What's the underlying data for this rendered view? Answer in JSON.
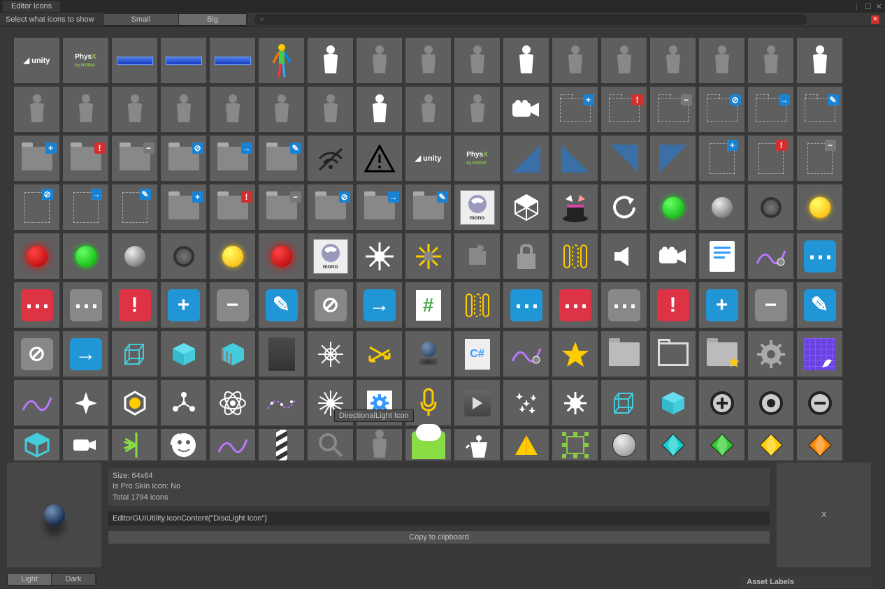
{
  "window": {
    "title": "Editor Icons",
    "controls": {
      "kebab": "⋮",
      "max": "☐",
      "close": "✕"
    }
  },
  "toolbar": {
    "label": "Select what icons to show",
    "sizes": {
      "small": "Small",
      "big": "Big"
    },
    "search_placeholder": "",
    "search_icon": "⌕"
  },
  "tooltip": "DirectionalLight Icon",
  "detail": {
    "size_label": "Size: 64x64",
    "proskin_label": "Is Pro Skin Icon: No",
    "total_label": "Total 1794 icons",
    "code": "EditorGUIUtility.IconContent(\"DiscLight Icon\")",
    "copy_label": "Copy to clipboard",
    "assign_label": "X"
  },
  "theme": {
    "light": "Light",
    "dark": "Dark"
  },
  "asset_labels": "Asset Labels",
  "icons": {
    "r0": [
      "unity",
      "physx",
      "bluebar",
      "bluebar",
      "bluebar",
      "avatar-color",
      "avatar-white",
      "avatar-outline",
      "avatar-dotted",
      "head",
      "head-white",
      "bodypart-1",
      "bodypart-2",
      "bodypart-3",
      "bodypart-4",
      "hand-outline",
      "hand-white"
    ],
    "r1": [
      "leg-1",
      "leg-2",
      "leg-3",
      "arm",
      "shoulder",
      "arm-2",
      "hand-outline-2",
      "hand-white-2",
      "torso",
      "torso-2",
      "camera-white",
      "folder-dashed-plus-blue",
      "folder-dashed-exclaim-red",
      "folder-dashed-minus-gray",
      "folder-dashed-noentry-blue",
      "folder-dashed-arrow-blue",
      "folder-dashed-pencil-blue"
    ],
    "r2": [
      "folder-plus-blue",
      "folder-exclaim-red",
      "folder-minus-gray",
      "folder-noentry-blue",
      "folder-arrow-blue",
      "folder-pencil-blue",
      "wifi-off",
      "warning-triangle",
      "unity-2",
      "physx-2",
      "tri-br-blue",
      "tri-bl-blue",
      "tri-tr-blue",
      "tri-tl-blue",
      "doc-dashed-plus-blue",
      "doc-dashed-exclaim-red",
      "doc-dashed-minus-gray"
    ],
    "r3": [
      "doc-dashed-noentry-blue",
      "doc-dashed-arrow-blue",
      "doc-dashed-pencil-blue",
      "folder-plus-blue-2",
      "folder-exclaim-red-2",
      "folder-minus-gray-2",
      "folder-noentry-blue-2",
      "folder-arrow-blue-2",
      "folder-pencil-blue-2",
      "mono-logo",
      "unity-cube",
      "magic-hat",
      "refresh-c",
      "green-yarn",
      "sphere-metal",
      "ring",
      "yellow-yarn"
    ],
    "r4": [
      "red-glow",
      "green-yarn-2",
      "sphere-metal-2",
      "ring-2",
      "yellow-glow",
      "red-glow-2",
      "mono-logo-2",
      "sun-outline",
      "sun-yellow",
      "puzzle",
      "lock",
      "columns-yellow",
      "speaker",
      "camera-white-2",
      "doc-lines-blue",
      "graph-purple",
      "more-blue"
    ],
    "r5": [
      "more-red",
      "more-gray",
      "exclaim-red",
      "plus-blue",
      "minus-gray",
      "pencil-blue",
      "noentry-gray",
      "arrow-blue",
      "hash-doc",
      "columns-yellow-2",
      "more-blue-2",
      "more-red-2",
      "more-gray-2",
      "exclaim-red-2",
      "plus-blue-2",
      "minus-gray-2",
      "pencil-blue-2"
    ],
    "r6": [
      "noentry-gray-2",
      "arrow-blue-2",
      "cube-wire-blue",
      "cube-solid-blue",
      "cube-stripe-blue",
      "slab-dark",
      "sun-rays",
      "swap-arrows-yellow",
      "sphere-shadow",
      "csharp-doc",
      "wave-purple",
      "star-yellow",
      "folder-fill",
      "folder-outline-thick",
      "folder-star",
      "gear",
      "grid-paint-blue"
    ],
    "r7": [
      "wave-purple-2",
      "sparkle-4",
      "hex-yellow",
      "molecule",
      "molecule-atom",
      "wave-dots",
      "sun-burst",
      "gear-blue",
      "mic-yellow",
      "play-button",
      "sparkles",
      "light-bulb",
      "cube-wire-blue-2",
      "cube-solid-blue-2",
      "radio-plus",
      "radio-dot",
      "radio-minus"
    ],
    "r8": [
      "cube-hollow",
      "camera-sm",
      "burst-green",
      "face-circle",
      "wave-purple-3",
      "barber",
      "search",
      "avatar-orange",
      "cloud-green",
      "kettle",
      "pyramid-yellow",
      "resize-handles",
      "sphere-gray",
      "diamond-teal",
      "diamond-green",
      "diamond-yellow",
      "diamond-orange"
    ]
  }
}
